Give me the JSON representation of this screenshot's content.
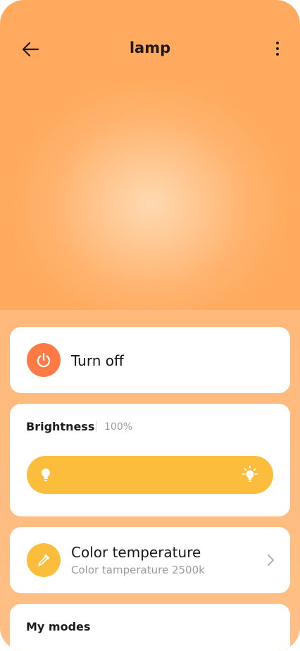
{
  "header": {
    "title": "lamp",
    "back_icon": "arrow-left-icon",
    "more_icon": "more-vertical-icon"
  },
  "power": {
    "label": "Turn off",
    "icon": "power-icon",
    "color": "#ff7a45"
  },
  "brightness": {
    "title": "Brightness",
    "value_text": "100%",
    "level": 1.0,
    "low_icon": "bulb-dim-icon",
    "high_icon": "bulb-bright-icon",
    "color": "#fcbc3c"
  },
  "color_temperature": {
    "title": "Color temperature",
    "subtitle": "Color tamperature 2500k",
    "icon": "eyedropper-icon",
    "color": "#fcbc3c"
  },
  "modes": {
    "title": "My modes"
  }
}
